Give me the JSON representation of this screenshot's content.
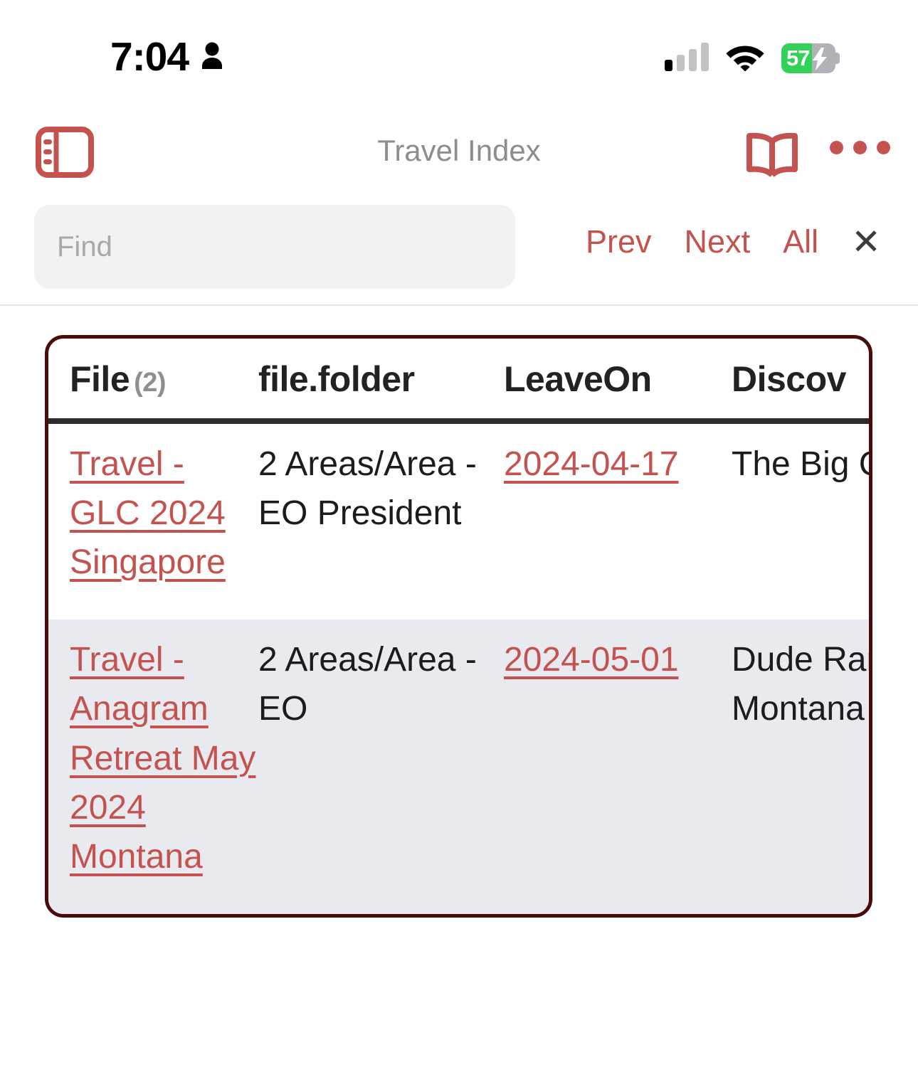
{
  "status_bar": {
    "time": "7:04",
    "person_icon": "person-icon",
    "signal_icon": "cellular-signal-icon",
    "wifi_icon": "wifi-icon",
    "battery_percent": "57",
    "battery_level": 57,
    "battery_charging": true,
    "battery_color": "#32d158"
  },
  "toolbar": {
    "sidebar_icon": "sidebar-toggle-icon",
    "title": "Travel Index",
    "book_icon": "open-book-icon",
    "more_icon": "ellipsis-icon",
    "accent_color": "#c4524e",
    "title_color": "#8c8c91"
  },
  "find_bar": {
    "placeholder": "Find",
    "value": "",
    "prev_label": "Prev",
    "next_label": "Next",
    "all_label": "All",
    "close_label": "✕"
  },
  "table": {
    "border_color": "#4a0b0b",
    "alt_row_color": "#e9eaef",
    "columns": [
      {
        "label": "File",
        "count": "(2)"
      },
      {
        "label": "file.folder",
        "count": ""
      },
      {
        "label": "LeaveOn",
        "count": ""
      },
      {
        "label": "Discov",
        "count": ""
      }
    ],
    "rows": [
      {
        "file": "Travel - GLC 2024 Singapore",
        "file_is_link": true,
        "folder": "2 Areas/Area - EO President",
        "leave_on": "2024-04-17",
        "leave_on_is_link": true,
        "discovery": "The Big GLC!"
      },
      {
        "file": "Travel - Anagram Retreat May 2024 Montana",
        "file_is_link": true,
        "folder": "2 Areas/Area - EO",
        "leave_on": "2024-05-01",
        "leave_on_is_link": true,
        "discovery": "Dude Ranch Montana"
      }
    ]
  }
}
